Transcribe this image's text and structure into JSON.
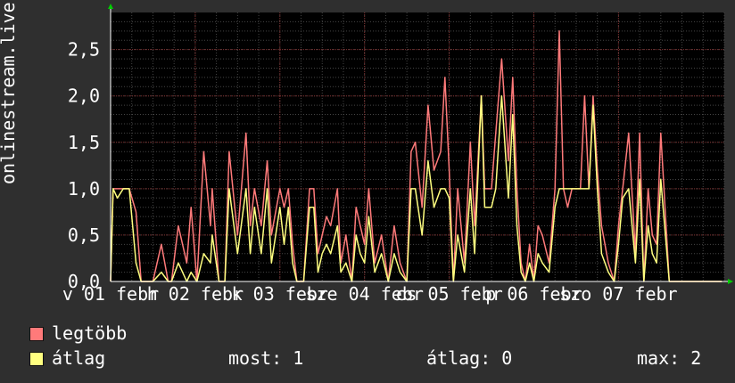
{
  "chart_data": {
    "type": "line",
    "ylabel": "onlinestream.live",
    "ylim": [
      0,
      2.9
    ],
    "yticks": [
      "0,0",
      "0,5",
      "1,0",
      "1,5",
      "2,0",
      "2,5"
    ],
    "ytick_values": [
      0,
      0.5,
      1.0,
      1.5,
      2.0,
      2.5
    ],
    "xticks": [
      "v 01 febr",
      "h 02 febr",
      "k 03 febr",
      "sze 04 febr",
      "cs 05 febr",
      "p 06 febr",
      "szo 07 febr"
    ],
    "xlim": [
      0,
      7.25
    ],
    "grid": true,
    "colors": {
      "max": "#ff7a7a",
      "avg": "#ffff80",
      "bg": "#000000",
      "grid": "#444444"
    },
    "series": [
      {
        "name": "legtöbb",
        "color": "#ff7a7a",
        "role": "max",
        "x": [
          0.0,
          0.03,
          0.08,
          0.15,
          0.22,
          0.3,
          0.36,
          0.4,
          0.44,
          0.5,
          0.6,
          0.68,
          0.72,
          0.8,
          0.9,
          0.95,
          1.02,
          1.1,
          1.18,
          1.2,
          1.28,
          1.35,
          1.4,
          1.5,
          1.6,
          1.65,
          1.7,
          1.78,
          1.85,
          1.9,
          2.0,
          2.05,
          2.1,
          2.15,
          2.2,
          2.28,
          2.35,
          2.4,
          2.45,
          2.5,
          2.55,
          2.6,
          2.68,
          2.72,
          2.78,
          2.85,
          2.9,
          2.95,
          3.0,
          3.05,
          3.12,
          3.2,
          3.28,
          3.35,
          3.42,
          3.5,
          3.55,
          3.6,
          3.68,
          3.75,
          3.82,
          3.9,
          3.95,
          4.0,
          4.05,
          4.1,
          4.18,
          4.25,
          4.3,
          4.38,
          4.42,
          4.5,
          4.55,
          4.62,
          4.7,
          4.75,
          4.8,
          4.85,
          4.9,
          4.95,
          5.0,
          5.05,
          5.1,
          5.18,
          5.25,
          5.3,
          5.35,
          5.4,
          5.45,
          5.5,
          5.55,
          5.6,
          5.65,
          5.7,
          5.75,
          5.8,
          5.88,
          5.95,
          6.0,
          6.05,
          6.12,
          6.2,
          6.25,
          6.3,
          6.35,
          6.4,
          6.45,
          6.5,
          6.6,
          6.7,
          6.75,
          6.8,
          6.88,
          6.95,
          7.0,
          7.05,
          7.1,
          7.15,
          7.22
        ],
        "values": [
          0,
          1.0,
          1.0,
          1.0,
          1.0,
          0.75,
          0,
          0,
          0,
          0,
          0.4,
          0,
          0,
          0.6,
          0.2,
          0.8,
          0,
          1.4,
          0.6,
          1.0,
          0,
          0,
          1.4,
          0.5,
          1.6,
          0.6,
          1.0,
          0.6,
          1.3,
          0.5,
          1.0,
          0.8,
          1.0,
          0.4,
          0,
          0,
          1.0,
          1.0,
          0.3,
          0.5,
          0.7,
          0.6,
          1.0,
          0.2,
          0.5,
          0,
          0.8,
          0.6,
          0.4,
          1.0,
          0.2,
          0.5,
          0,
          0.6,
          0.2,
          0,
          1.4,
          1.5,
          0.8,
          1.9,
          1.2,
          1.4,
          2.2,
          1.2,
          0,
          1.0,
          0.2,
          1.5,
          0.6,
          2.0,
          1.0,
          1.0,
          1.6,
          2.4,
          1.3,
          2.2,
          1.0,
          0.2,
          0,
          0.4,
          0,
          0.6,
          0.5,
          0.2,
          1.0,
          2.7,
          1.0,
          0.8,
          1.0,
          1.0,
          1.0,
          2.0,
          1.0,
          2.0,
          1.2,
          0.6,
          0.2,
          0,
          0.6,
          1.0,
          1.6,
          0.3,
          1.6,
          0,
          1.0,
          0.5,
          0.4,
          1.6,
          0,
          0,
          0,
          0,
          0,
          0,
          0,
          0,
          0,
          0,
          0
        ]
      },
      {
        "name": "átlag",
        "color": "#ffff80",
        "role": "avg",
        "x": [
          0.0,
          0.03,
          0.08,
          0.15,
          0.22,
          0.3,
          0.36,
          0.4,
          0.44,
          0.5,
          0.6,
          0.68,
          0.72,
          0.8,
          0.9,
          0.95,
          1.02,
          1.1,
          1.18,
          1.2,
          1.28,
          1.35,
          1.4,
          1.5,
          1.6,
          1.65,
          1.7,
          1.78,
          1.85,
          1.9,
          2.0,
          2.05,
          2.1,
          2.15,
          2.2,
          2.28,
          2.35,
          2.4,
          2.45,
          2.5,
          2.55,
          2.6,
          2.68,
          2.72,
          2.78,
          2.85,
          2.9,
          2.95,
          3.0,
          3.05,
          3.12,
          3.2,
          3.28,
          3.35,
          3.42,
          3.5,
          3.55,
          3.6,
          3.68,
          3.75,
          3.82,
          3.9,
          3.95,
          4.0,
          4.05,
          4.1,
          4.18,
          4.25,
          4.3,
          4.38,
          4.42,
          4.5,
          4.55,
          4.62,
          4.7,
          4.75,
          4.8,
          4.85,
          4.9,
          4.95,
          5.0,
          5.05,
          5.1,
          5.18,
          5.25,
          5.3,
          5.35,
          5.4,
          5.45,
          5.5,
          5.55,
          5.6,
          5.65,
          5.7,
          5.75,
          5.8,
          5.88,
          5.95,
          6.0,
          6.05,
          6.12,
          6.2,
          6.25,
          6.3,
          6.35,
          6.4,
          6.45,
          6.5,
          6.6,
          6.7,
          6.75,
          6.8,
          6.88,
          6.95,
          7.0,
          7.05,
          7.1,
          7.15,
          7.22
        ],
        "values": [
          0,
          1.0,
          0.9,
          1.0,
          1.0,
          0.2,
          0,
          0,
          0,
          0,
          0.1,
          0,
          0,
          0.2,
          0,
          0.1,
          0,
          0.3,
          0.2,
          0.5,
          0,
          0,
          1.0,
          0.3,
          1.0,
          0.3,
          0.8,
          0.3,
          1.0,
          0.2,
          0.8,
          0.4,
          0.8,
          0.2,
          0,
          0,
          0.8,
          0.8,
          0.1,
          0.3,
          0.4,
          0.3,
          0.6,
          0.1,
          0.2,
          0,
          0.5,
          0.3,
          0.2,
          0.7,
          0.1,
          0.3,
          0,
          0.3,
          0.1,
          0,
          1.0,
          1.0,
          0.5,
          1.3,
          0.8,
          1.0,
          1.0,
          0.9,
          0,
          0.5,
          0.1,
          1.0,
          0.3,
          2.0,
          0.8,
          0.8,
          1.0,
          2.0,
          0.9,
          1.8,
          0.6,
          0.1,
          0,
          0.2,
          0,
          0.3,
          0.2,
          0.1,
          0.8,
          1.0,
          1.0,
          1.0,
          1.0,
          1.0,
          1.0,
          1.0,
          1.0,
          1.9,
          1.0,
          0.3,
          0.1,
          0,
          0.4,
          0.9,
          1.0,
          0.2,
          1.1,
          0,
          0.6,
          0.3,
          0.2,
          1.1,
          0,
          0,
          0,
          0,
          0,
          0,
          0,
          0,
          0,
          0,
          0
        ]
      }
    ]
  },
  "legend": {
    "max_label": "legtöbb",
    "avg_label": "átlag",
    "now": "most: 1",
    "average": "átlag: 0",
    "maximum": "max: 2"
  }
}
